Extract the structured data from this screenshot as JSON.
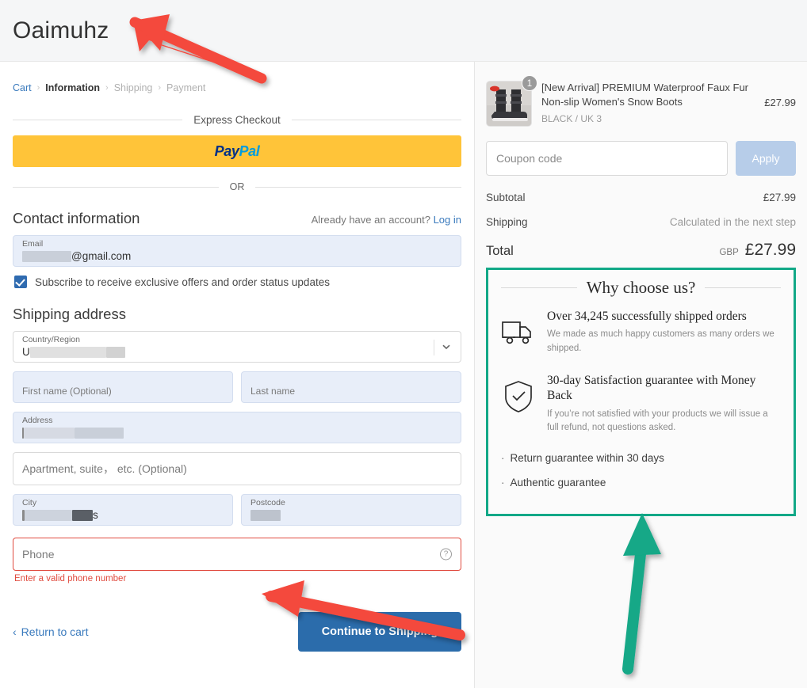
{
  "header": {
    "store_title": "Oaimuhz"
  },
  "breadcrumb": {
    "cart": "Cart",
    "information": "Information",
    "shipping": "Shipping",
    "payment": "Payment",
    "separator": "›"
  },
  "express": {
    "divider_label": "Express Checkout",
    "paypal_pay": "Pay",
    "paypal_pal": "Pal",
    "or_label": "OR"
  },
  "contact": {
    "title": "Contact information",
    "account_prompt": "Already have an account?",
    "login_link": "Log in",
    "email_label": "Email",
    "email_value_suffix": "@gmail.com",
    "subscribe_label": "Subscribe to receive exclusive offers and order status updates"
  },
  "shipping_address": {
    "title": "Shipping address",
    "country_label": "Country/Region",
    "country_value_prefix": "U",
    "first_name_placeholder": "First name (Optional)",
    "last_name_placeholder": "Last name",
    "address_label": "Address",
    "apartment_placeholder": "Apartment, suite， etc. (Optional)",
    "city_label": "City",
    "city_value_suffix": "s",
    "postcode_label": "Postcode",
    "phone_placeholder": "Phone",
    "phone_error": "Enter a valid phone number"
  },
  "actions": {
    "return_to_cart": "Return to cart",
    "continue": "Continue to Shipping",
    "back_chevron": "‹"
  },
  "summary": {
    "product": {
      "name": "[New Arrival] PREMIUM Waterproof Faux Fur Non-slip Women's Snow Boots",
      "variant": "BLACK / UK 3",
      "price": "£27.99",
      "quantity": "1"
    },
    "coupon_placeholder": "Coupon code",
    "apply_label": "Apply",
    "subtotal_label": "Subtotal",
    "subtotal_value": "£27.99",
    "shipping_label": "Shipping",
    "shipping_value": "Calculated in the next step",
    "total_label": "Total",
    "total_currency": "GBP",
    "total_value": "£27.99"
  },
  "why_choose_us": {
    "title": "Why choose us?",
    "items": [
      {
        "icon": "truck-icon",
        "heading": "Over 34,245 successfully shipped orders",
        "body": "We made as much happy customers as many orders we shipped."
      },
      {
        "icon": "shield-check-icon",
        "heading": "30-day Satisfaction guarantee with Money Back",
        "body": "If you’re not satisfied with your products we will issue a full refund, not questions asked."
      }
    ],
    "bullets": [
      "Return guarantee within 30 days",
      "Authentic guarantee"
    ],
    "bullet_marker": "·"
  },
  "colors": {
    "accent_blue": "#2b6cab",
    "link_blue": "#3a7abd",
    "paypal_yellow": "#ffc439",
    "error_red": "#e04b3f",
    "highlight_green": "#12a887",
    "annotation_red": "#f4483c",
    "filled_field_blue": "#e8eef9"
  }
}
